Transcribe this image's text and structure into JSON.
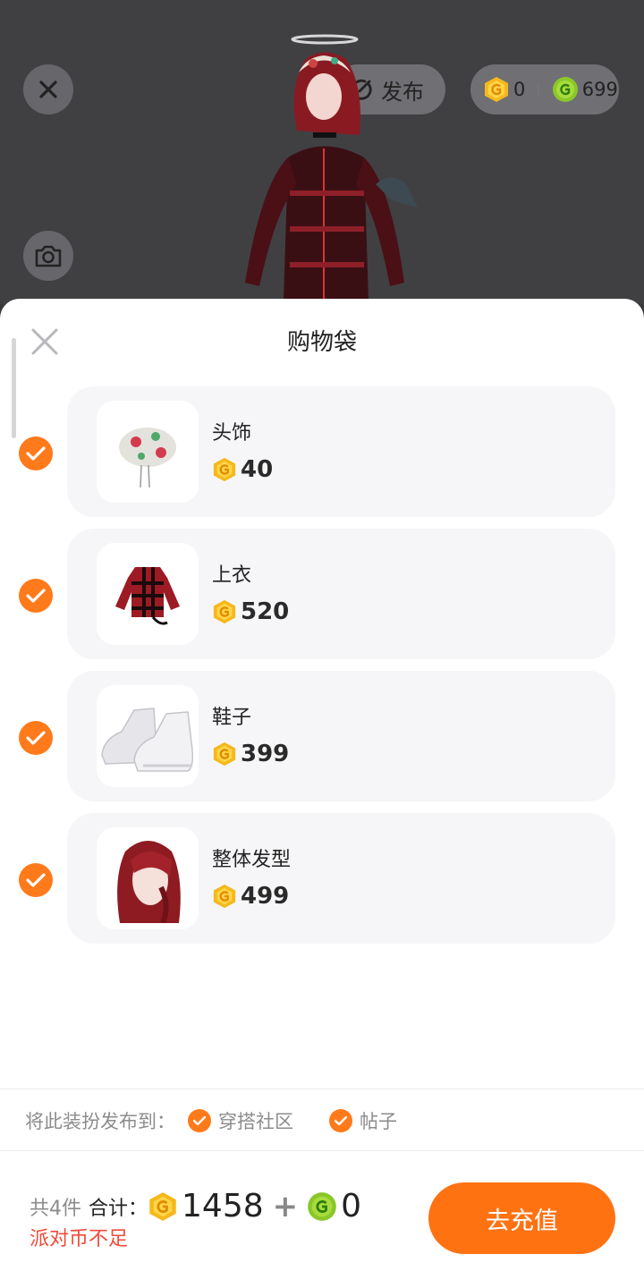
{
  "header": {
    "publish_label": "发布",
    "gold_balance": "0",
    "green_balance": "699"
  },
  "sheet": {
    "title": "购物袋",
    "items": [
      {
        "name": "头饰",
        "price": "40",
        "checked": true
      },
      {
        "name": "上衣",
        "price": "520",
        "checked": true
      },
      {
        "name": "鞋子",
        "price": "399",
        "checked": true
      },
      {
        "name": "整体发型",
        "price": "499",
        "checked": true
      }
    ]
  },
  "share": {
    "label": "将此装扮发布到：",
    "options": [
      {
        "label": "穿搭社区",
        "checked": true
      },
      {
        "label": "帖子",
        "checked": true
      }
    ]
  },
  "footer": {
    "count_text": "共4件",
    "sum_label": "合计：",
    "gold_total": "1458",
    "plus": "+",
    "green_total": "0",
    "warning": "派对币不足",
    "recharge_label": "去充值"
  },
  "colors": {
    "accent": "#ff7a1a",
    "gold_coin": "#f5b81c",
    "green_coin": "#8ac72a",
    "warning": "#f04a3a"
  }
}
